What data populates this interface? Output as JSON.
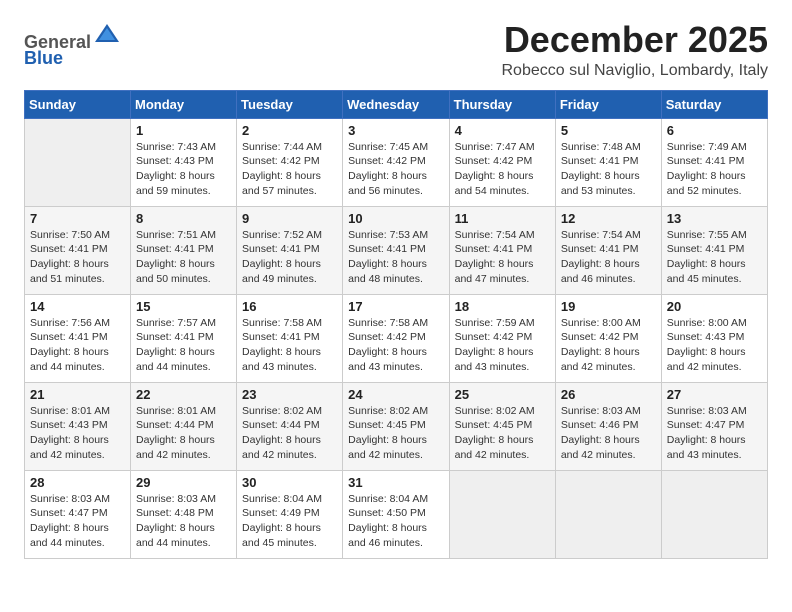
{
  "header": {
    "logo_line1": "General",
    "logo_line2": "Blue",
    "month": "December 2025",
    "location": "Robecco sul Naviglio, Lombardy, Italy"
  },
  "days_of_week": [
    "Sunday",
    "Monday",
    "Tuesday",
    "Wednesday",
    "Thursday",
    "Friday",
    "Saturday"
  ],
  "weeks": [
    [
      {
        "day": "",
        "sunrise": "",
        "sunset": "",
        "daylight": ""
      },
      {
        "day": "1",
        "sunrise": "Sunrise: 7:43 AM",
        "sunset": "Sunset: 4:43 PM",
        "daylight": "Daylight: 8 hours and 59 minutes."
      },
      {
        "day": "2",
        "sunrise": "Sunrise: 7:44 AM",
        "sunset": "Sunset: 4:42 PM",
        "daylight": "Daylight: 8 hours and 57 minutes."
      },
      {
        "day": "3",
        "sunrise": "Sunrise: 7:45 AM",
        "sunset": "Sunset: 4:42 PM",
        "daylight": "Daylight: 8 hours and 56 minutes."
      },
      {
        "day": "4",
        "sunrise": "Sunrise: 7:47 AM",
        "sunset": "Sunset: 4:42 PM",
        "daylight": "Daylight: 8 hours and 54 minutes."
      },
      {
        "day": "5",
        "sunrise": "Sunrise: 7:48 AM",
        "sunset": "Sunset: 4:41 PM",
        "daylight": "Daylight: 8 hours and 53 minutes."
      },
      {
        "day": "6",
        "sunrise": "Sunrise: 7:49 AM",
        "sunset": "Sunset: 4:41 PM",
        "daylight": "Daylight: 8 hours and 52 minutes."
      }
    ],
    [
      {
        "day": "7",
        "sunrise": "Sunrise: 7:50 AM",
        "sunset": "Sunset: 4:41 PM",
        "daylight": "Daylight: 8 hours and 51 minutes."
      },
      {
        "day": "8",
        "sunrise": "Sunrise: 7:51 AM",
        "sunset": "Sunset: 4:41 PM",
        "daylight": "Daylight: 8 hours and 50 minutes."
      },
      {
        "day": "9",
        "sunrise": "Sunrise: 7:52 AM",
        "sunset": "Sunset: 4:41 PM",
        "daylight": "Daylight: 8 hours and 49 minutes."
      },
      {
        "day": "10",
        "sunrise": "Sunrise: 7:53 AM",
        "sunset": "Sunset: 4:41 PM",
        "daylight": "Daylight: 8 hours and 48 minutes."
      },
      {
        "day": "11",
        "sunrise": "Sunrise: 7:54 AM",
        "sunset": "Sunset: 4:41 PM",
        "daylight": "Daylight: 8 hours and 47 minutes."
      },
      {
        "day": "12",
        "sunrise": "Sunrise: 7:54 AM",
        "sunset": "Sunset: 4:41 PM",
        "daylight": "Daylight: 8 hours and 46 minutes."
      },
      {
        "day": "13",
        "sunrise": "Sunrise: 7:55 AM",
        "sunset": "Sunset: 4:41 PM",
        "daylight": "Daylight: 8 hours and 45 minutes."
      }
    ],
    [
      {
        "day": "14",
        "sunrise": "Sunrise: 7:56 AM",
        "sunset": "Sunset: 4:41 PM",
        "daylight": "Daylight: 8 hours and 44 minutes."
      },
      {
        "day": "15",
        "sunrise": "Sunrise: 7:57 AM",
        "sunset": "Sunset: 4:41 PM",
        "daylight": "Daylight: 8 hours and 44 minutes."
      },
      {
        "day": "16",
        "sunrise": "Sunrise: 7:58 AM",
        "sunset": "Sunset: 4:41 PM",
        "daylight": "Daylight: 8 hours and 43 minutes."
      },
      {
        "day": "17",
        "sunrise": "Sunrise: 7:58 AM",
        "sunset": "Sunset: 4:42 PM",
        "daylight": "Daylight: 8 hours and 43 minutes."
      },
      {
        "day": "18",
        "sunrise": "Sunrise: 7:59 AM",
        "sunset": "Sunset: 4:42 PM",
        "daylight": "Daylight: 8 hours and 43 minutes."
      },
      {
        "day": "19",
        "sunrise": "Sunrise: 8:00 AM",
        "sunset": "Sunset: 4:42 PM",
        "daylight": "Daylight: 8 hours and 42 minutes."
      },
      {
        "day": "20",
        "sunrise": "Sunrise: 8:00 AM",
        "sunset": "Sunset: 4:43 PM",
        "daylight": "Daylight: 8 hours and 42 minutes."
      }
    ],
    [
      {
        "day": "21",
        "sunrise": "Sunrise: 8:01 AM",
        "sunset": "Sunset: 4:43 PM",
        "daylight": "Daylight: 8 hours and 42 minutes."
      },
      {
        "day": "22",
        "sunrise": "Sunrise: 8:01 AM",
        "sunset": "Sunset: 4:44 PM",
        "daylight": "Daylight: 8 hours and 42 minutes."
      },
      {
        "day": "23",
        "sunrise": "Sunrise: 8:02 AM",
        "sunset": "Sunset: 4:44 PM",
        "daylight": "Daylight: 8 hours and 42 minutes."
      },
      {
        "day": "24",
        "sunrise": "Sunrise: 8:02 AM",
        "sunset": "Sunset: 4:45 PM",
        "daylight": "Daylight: 8 hours and 42 minutes."
      },
      {
        "day": "25",
        "sunrise": "Sunrise: 8:02 AM",
        "sunset": "Sunset: 4:45 PM",
        "daylight": "Daylight: 8 hours and 42 minutes."
      },
      {
        "day": "26",
        "sunrise": "Sunrise: 8:03 AM",
        "sunset": "Sunset: 4:46 PM",
        "daylight": "Daylight: 8 hours and 42 minutes."
      },
      {
        "day": "27",
        "sunrise": "Sunrise: 8:03 AM",
        "sunset": "Sunset: 4:47 PM",
        "daylight": "Daylight: 8 hours and 43 minutes."
      }
    ],
    [
      {
        "day": "28",
        "sunrise": "Sunrise: 8:03 AM",
        "sunset": "Sunset: 4:47 PM",
        "daylight": "Daylight: 8 hours and 44 minutes."
      },
      {
        "day": "29",
        "sunrise": "Sunrise: 8:03 AM",
        "sunset": "Sunset: 4:48 PM",
        "daylight": "Daylight: 8 hours and 44 minutes."
      },
      {
        "day": "30",
        "sunrise": "Sunrise: 8:04 AM",
        "sunset": "Sunset: 4:49 PM",
        "daylight": "Daylight: 8 hours and 45 minutes."
      },
      {
        "day": "31",
        "sunrise": "Sunrise: 8:04 AM",
        "sunset": "Sunset: 4:50 PM",
        "daylight": "Daylight: 8 hours and 46 minutes."
      },
      {
        "day": "",
        "sunrise": "",
        "sunset": "",
        "daylight": ""
      },
      {
        "day": "",
        "sunrise": "",
        "sunset": "",
        "daylight": ""
      },
      {
        "day": "",
        "sunrise": "",
        "sunset": "",
        "daylight": ""
      }
    ]
  ]
}
